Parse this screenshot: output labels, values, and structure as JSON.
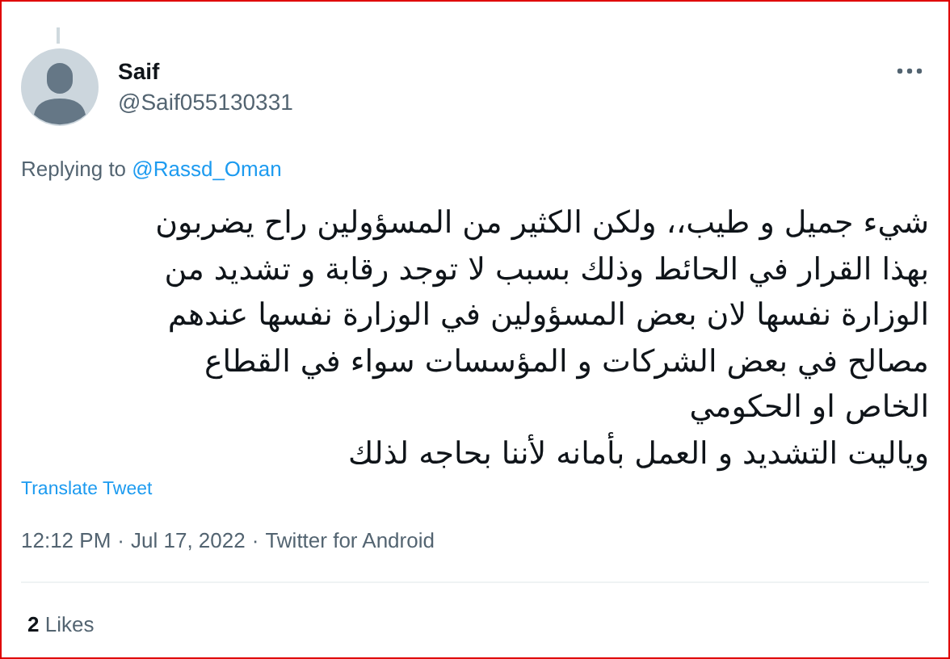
{
  "author": {
    "name": "Saif",
    "handle": "@Saif055130331"
  },
  "reply": {
    "label": "Replying to",
    "mention": "@Rassd_Oman"
  },
  "tweet_lines": [
    "شيء جميل و طيب،، ولكن الكثير من المسؤولين راح يضربون",
    "بهذا القرار في الحائط وذلك بسبب لا توجد رقابة و تشديد من",
    "الوزارة نفسها لان بعض المسؤولين في الوزارة نفسها عندهم",
    "مصالح في بعض الشركات و المؤسسات سواء في القطاع",
    "الخاص او الحكومي",
    "وياليت التشديد و العمل بأمانه لأننا بحاجه لذلك"
  ],
  "translate": "Translate Tweet",
  "meta": {
    "time": "12:12 PM",
    "date": "Jul 17, 2022",
    "source": "Twitter for Android",
    "separator": "·"
  },
  "likes": {
    "count": "2",
    "label": "Likes"
  }
}
